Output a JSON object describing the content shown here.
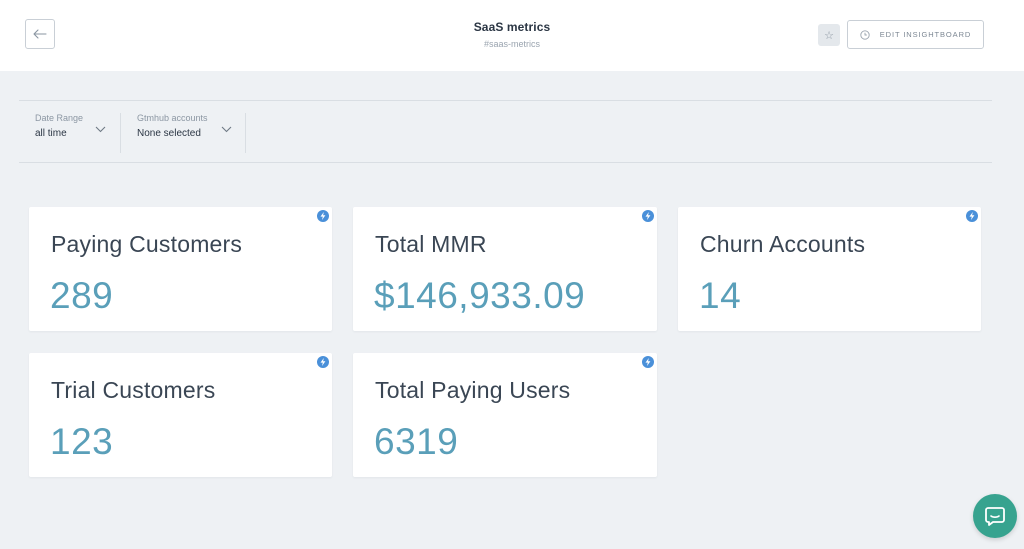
{
  "header": {
    "title": "SaaS metrics",
    "subtitle": "#saas-metrics",
    "star_label": "☆",
    "edit_label": "EDIT INSIGHTBOARD"
  },
  "filters": [
    {
      "label": "Date Range",
      "value": "all time"
    },
    {
      "label": "Gtmhub accounts",
      "value": "None selected"
    }
  ],
  "cards": [
    {
      "title": "Paying Customers",
      "value": "289"
    },
    {
      "title": "Total MMR",
      "value": "$146,933.09"
    },
    {
      "title": "Churn Accounts",
      "value": "14"
    },
    {
      "title": "Trial Customers",
      "value": "123"
    },
    {
      "title": "Total Paying Users",
      "value": "6319"
    }
  ],
  "colors": {
    "accent": "#5a9fb9",
    "bolt": "#4a90d9",
    "chat": "#37a38f",
    "background": "#eef1f4"
  },
  "icons": {
    "back": "arrow-left-icon",
    "star": "star-icon",
    "edit": "clock-icon",
    "dropdown": "chevron-down-icon",
    "card_action": "bolt-icon",
    "chat": "chat-bubble-icon"
  }
}
